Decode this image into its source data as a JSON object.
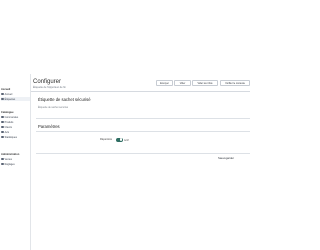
{
  "sidebar": {
    "sections": [
      {
        "title": "Accueil",
        "items": [
          {
            "label": "Accueil",
            "icon": "home-icon"
          },
          {
            "label": "Étiquettes",
            "icon": "tag-icon"
          }
        ]
      },
      {
        "title": "Catalogue",
        "items": [
          {
            "label": "Commandes",
            "icon": "order-icon"
          },
          {
            "label": "Produits",
            "icon": "box-icon"
          },
          {
            "label": "Clients",
            "icon": "user-icon"
          },
          {
            "label": "Avis",
            "icon": "star-icon"
          },
          {
            "label": "Statistiques",
            "icon": "chart-icon"
          }
        ]
      },
      {
        "title": "Administration",
        "items": [
          {
            "label": "Ventes",
            "icon": "cart-icon"
          },
          {
            "label": "Réglages",
            "icon": "gear-icon"
          }
        ]
      }
    ],
    "active_item": "Étiquettes"
  },
  "header": {
    "title": "Configurer",
    "subtitle": "Étiquette de l'Apporteur de fin",
    "buttons": [
      "Envoyer",
      "Vider",
      "Vider les infos",
      "Vérifier le contexte"
    ]
  },
  "card1": {
    "title": "Étiquette de sachet sécurisé",
    "subtitle": "Étiquette de sachet sécurisé"
  },
  "card2": {
    "title": "Paramètres",
    "field_label": "Répertoire",
    "toggle_state": "Actif",
    "toggle_on": true
  },
  "footer": {
    "save_label": "Sauvegarder"
  },
  "colors": {
    "accent": "#2f6e63",
    "sidebar_active": "#eef1f5"
  }
}
